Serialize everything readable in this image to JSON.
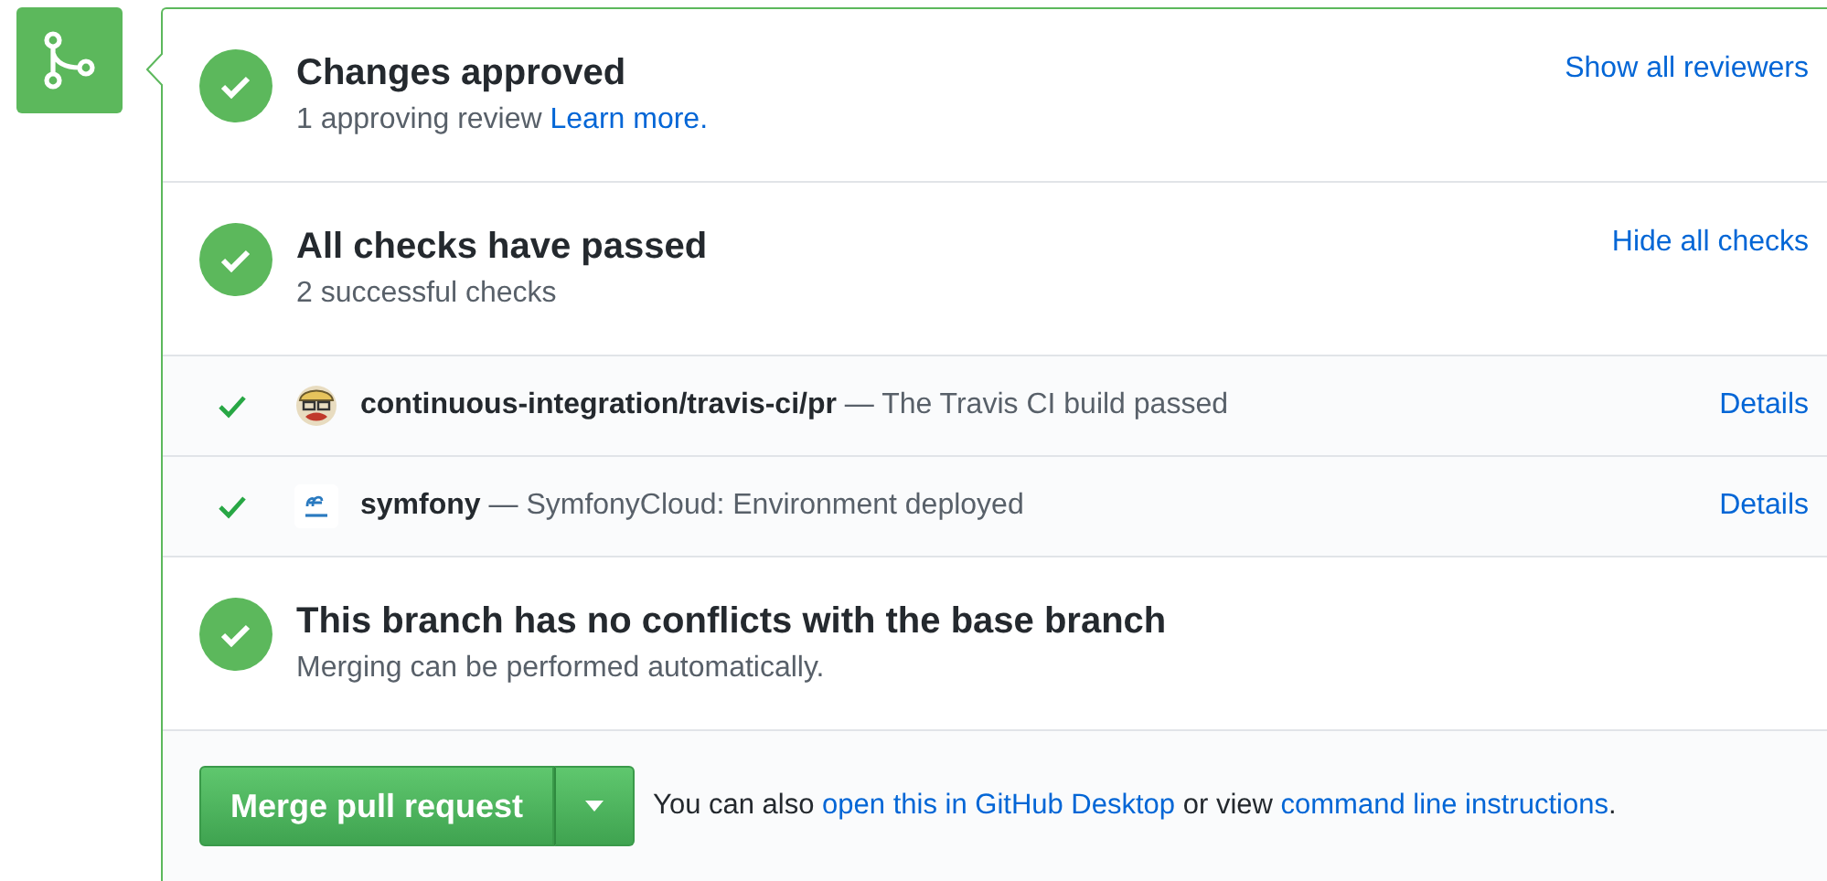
{
  "review": {
    "title": "Changes approved",
    "summary": "1 approving review",
    "link": "Learn more.",
    "action": "Show all reviewers"
  },
  "checks": {
    "title": "All checks have passed",
    "summary": "2 successful checks",
    "action": "Hide all checks",
    "items": [
      {
        "kind": "travis",
        "name": "continuous-integration/travis-ci/pr",
        "description": " — The Travis CI build passed",
        "link": "Details"
      },
      {
        "kind": "symfony",
        "name": "symfony",
        "description": " — SymfonyCloud: Environment deployed",
        "link": "Details"
      }
    ]
  },
  "conflicts": {
    "title": "This branch has no conflicts with the base branch",
    "summary": "Merging can be performed automatically."
  },
  "merge": {
    "button": "Merge pull request",
    "text_1": "You can also ",
    "link_1": "open this in GitHub Desktop",
    "text_2": " or view ",
    "link_2": "command line instructions",
    "text_3": "."
  }
}
